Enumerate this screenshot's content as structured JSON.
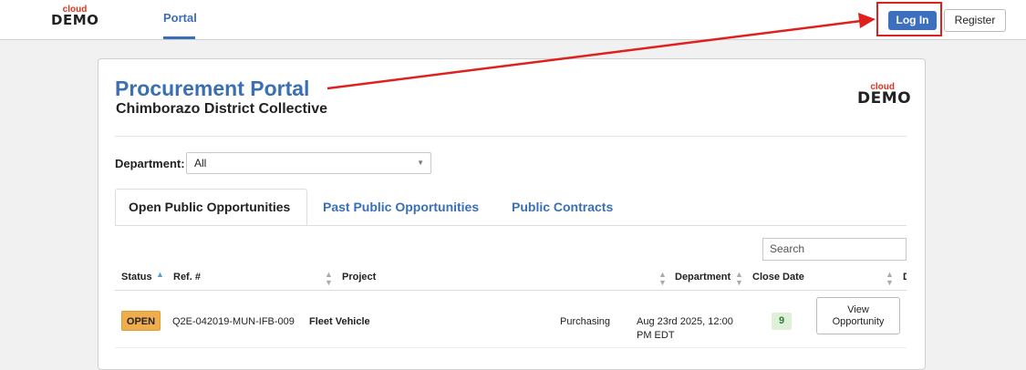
{
  "header": {
    "logo": {
      "cloud": "cloud",
      "demo": "DEMO"
    },
    "nav": {
      "portal": "Portal"
    },
    "login_label": "Log In",
    "register_label": "Register"
  },
  "portal": {
    "title": "Procurement Portal",
    "subtitle": "Chimborazo District Collective",
    "logo": {
      "cloud": "cloud",
      "demo": "DEMO"
    }
  },
  "filter": {
    "department_label": "Department:",
    "department_value": "All"
  },
  "tabs": [
    {
      "label": "Open Public Opportunities",
      "active": true
    },
    {
      "label": "Past Public Opportunities",
      "active": false
    },
    {
      "label": "Public Contracts",
      "active": false
    }
  ],
  "search": {
    "placeholder": "Search"
  },
  "table": {
    "columns": [
      "Status",
      "Ref. #",
      "Project",
      "Department",
      "Close Date",
      "D"
    ],
    "rows": [
      {
        "status": "OPEN",
        "ref": "Q2E-042019-MUN-IFB-009",
        "project": "Fleet Vehicle",
        "department": "Purchasing",
        "due_line1": "Aug 23rd 2025, 12:00",
        "due_line2": "PM EDT",
        "close_days": "9",
        "action_line1": "View",
        "action_line2": "Opportunity"
      }
    ]
  },
  "colors": {
    "accent": "#3a6fb5",
    "button_primary": "#3d6fbf",
    "highlight": "#e0201c",
    "open_badge": "#f0ad4e",
    "close_badge_bg": "#dff0d8",
    "logo_red": "#e0321c"
  },
  "icons": [
    "sort-asc-icon",
    "sort-icon",
    "dropdown-caret-icon"
  ]
}
